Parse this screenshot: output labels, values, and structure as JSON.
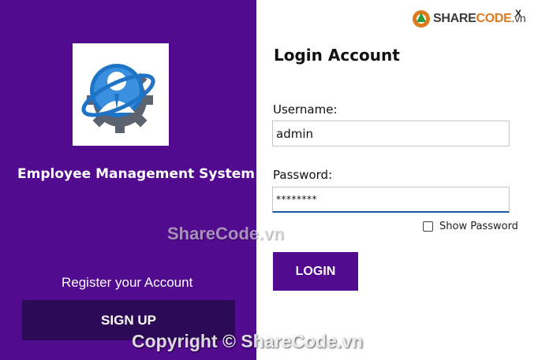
{
  "brand": {
    "logo_text_main": "SHARE",
    "logo_text_accent": "CODE",
    "logo_text_domain": ".vn",
    "corner_mark": "X"
  },
  "left_panel": {
    "app_title": "Employee Management System",
    "register_text": "Register your Account",
    "signup_label": "SIGN UP",
    "background_color": "#520b8e",
    "button_color": "#2c0a56"
  },
  "login_form": {
    "title": "Login Account",
    "username_label": "Username:",
    "username_value": "admin",
    "password_label": "Password:",
    "password_value": "********",
    "show_password_label": "Show Password",
    "show_password_checked": false,
    "login_label": "LOGIN",
    "accent_color": "#520b8e"
  },
  "watermarks": {
    "center": "ShareCode.vn",
    "bottom": "Copyright © ShareCode.vn"
  }
}
